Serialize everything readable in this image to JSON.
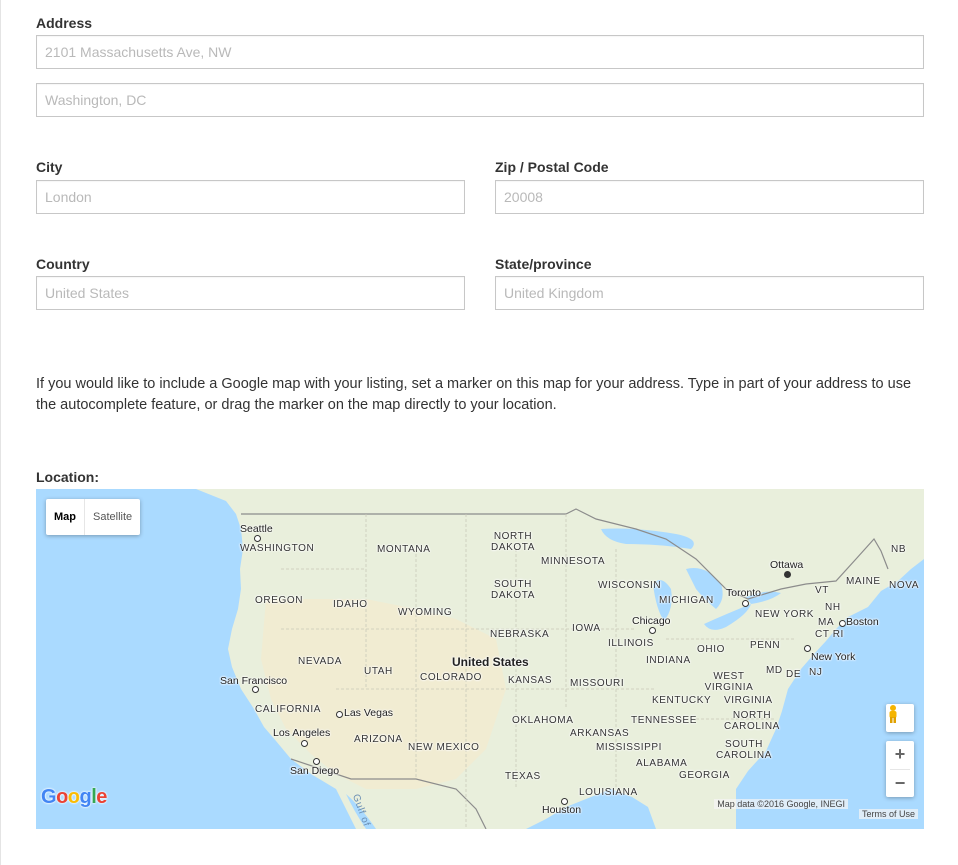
{
  "address": {
    "label": "Address",
    "line1_placeholder": "2101 Massachusetts Ave, NW",
    "line2_placeholder": "Washington, DC"
  },
  "city": {
    "label": "City",
    "placeholder": "London"
  },
  "zip": {
    "label": "Zip / Postal Code",
    "placeholder": "20008"
  },
  "country": {
    "label": "Country",
    "placeholder": "United States"
  },
  "state": {
    "label": "State/province",
    "placeholder": "United Kingdom"
  },
  "help_text": "If you would like to include a Google map with your listing, set a marker on this map for your address. Type in part of your address to use the autocomplete feature, or drag the marker on the map directly to your location.",
  "location": {
    "label": "Location:"
  },
  "map": {
    "type_buttons": {
      "map": "Map",
      "satellite": "Satellite"
    },
    "attribution": "Map data ©2016 Google, INEGI",
    "terms": "Terms of Use",
    "zoom_in": "+",
    "zoom_out": "−",
    "logo": [
      "G",
      "o",
      "o",
      "g",
      "l",
      "e"
    ],
    "logo_colors": [
      "#4285F4",
      "#EA4335",
      "#FBBC05",
      "#4285F4",
      "#34A853",
      "#EA4335"
    ],
    "country_label": "United States",
    "cities": [
      "Seattle",
      "Ottawa",
      "Toronto",
      "Chicago",
      "Boston",
      "New York",
      "San Francisco",
      "Las Vegas",
      "Los Angeles",
      "San Diego",
      "Houston"
    ],
    "states": [
      "WASHINGTON",
      "MONTANA",
      "NORTH DAKOTA",
      "MINNESOTA",
      "OREGON",
      "IDAHO",
      "WYOMING",
      "SOUTH DAKOTA",
      "WISCONSIN",
      "MICHIGAN",
      "NEBRASKA",
      "IOWA",
      "ILLINOIS",
      "NEVADA",
      "UTAH",
      "COLORADO",
      "KANSAS",
      "MISSOURI",
      "INDIANA",
      "OHIO",
      "PENN",
      "NEW YORK",
      "VT",
      "NH",
      "MA",
      "CT RI",
      "MAINE",
      "NB",
      "NOVA",
      "MD",
      "DE",
      "NJ",
      "WEST VIRGINIA",
      "VIRGINIA",
      "KENTUCKY",
      "CALIFORNIA",
      "ARIZONA",
      "NEW MEXICO",
      "OKLAHOMA",
      "TENNESSEE",
      "NORTH CAROLINA",
      "ARKANSAS",
      "SOUTH CAROLINA",
      "MISSISSIPPI",
      "ALABAMA",
      "GEORGIA",
      "TEXAS",
      "LOUISIANA"
    ],
    "water": [
      "Gulf of"
    ]
  },
  "colors": {
    "land": "#e9efdc",
    "desert": "#f1ecd2",
    "water": "#aadaff",
    "border": "#8c8c8c"
  }
}
